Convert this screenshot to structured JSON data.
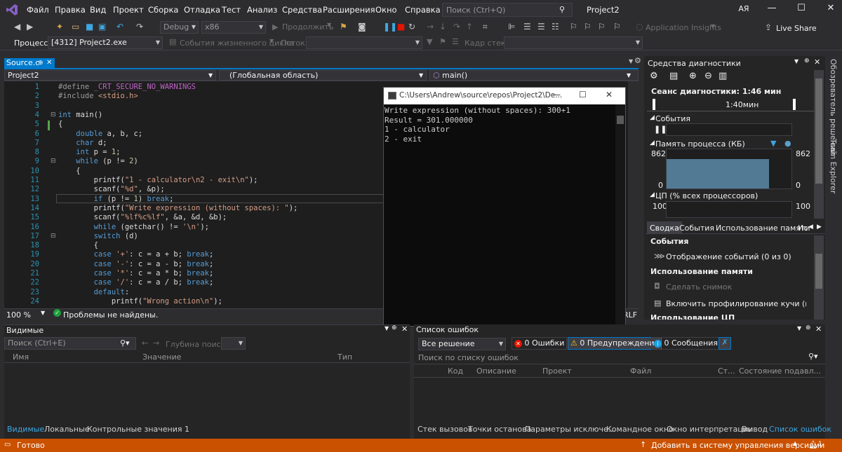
{
  "menu": [
    "Файл",
    "Правка",
    "Вид",
    "Проект",
    "Сборка",
    "Отладка",
    "Тест",
    "Анализ",
    "Средства",
    "Расширения",
    "Окно",
    "Справка"
  ],
  "search": {
    "placeholder": "Поиск (Ctrl+Q)"
  },
  "title": "Project2",
  "avatar": "АЯ",
  "toolbar": {
    "config": "Debug",
    "platform": "x86",
    "continue": "Продолжить",
    "insights": "Application Insights",
    "liveshare": "Live Share"
  },
  "toolbar2": {
    "process_label": "Процесс:",
    "process_value": "[4312] Project2.exe",
    "lifecycle": "События жизненного цикла",
    "thread": "Поток:",
    "frame": "Кадр стека:"
  },
  "editor": {
    "tab": "Source.c",
    "nav_project": "Project2",
    "nav_scope": "(Глобальная область)",
    "nav_func": "main()",
    "zoom": "100 %",
    "issues": "Проблемы не найдены.",
    "lines": [
      {
        "n": "1",
        "html": "<span class=\"pp\">#define</span> <span class=\"mac\">_CRT_SECURE_NO_WARNINGS</span>"
      },
      {
        "n": "2",
        "html": "<span class=\"pp\">#include</span> <span class=\"str\">&lt;stdio.h&gt;</span>"
      },
      {
        "n": "3",
        "html": ""
      },
      {
        "n": "4",
        "html": "<span class=\"kw\">int</span> main()"
      },
      {
        "n": "5",
        "html": "{"
      },
      {
        "n": "6",
        "html": "    <span class=\"kw\">double</span> a, b, c;"
      },
      {
        "n": "7",
        "html": "    <span class=\"kw\">char</span> d;"
      },
      {
        "n": "8",
        "html": "    <span class=\"kw\">int</span> p = <span class=\"num\">1</span>;"
      },
      {
        "n": "9",
        "html": "    <span class=\"kw\">while</span> (p != <span class=\"num\">2</span>)"
      },
      {
        "n": "10",
        "html": "    {"
      },
      {
        "n": "11",
        "html": "        printf(<span class=\"str\">\"1 - calculator\\n2 - exit\\n\"</span>);"
      },
      {
        "n": "12",
        "html": "        scanf(<span class=\"str\">\"%d\"</span>, &amp;p);"
      },
      {
        "n": "13",
        "html": "        <span class=\"kw\">if</span> (p != <span class=\"num\">1</span>) <span class=\"kw\">break</span>;"
      },
      {
        "n": "14",
        "html": "        printf(<span class=\"str\">\"Write expression (without spaces): \"</span>);"
      },
      {
        "n": "15",
        "html": "        scanf(<span class=\"str\">\"%lf%c%lf\"</span>, &amp;a, &amp;d, &amp;b);"
      },
      {
        "n": "16",
        "html": "        <span class=\"kw\">while</span> (getchar() != <span class=\"str\">'\\n'</span>);"
      },
      {
        "n": "17",
        "html": "        <span class=\"kw\">switch</span> (d)"
      },
      {
        "n": "18",
        "html": "        {"
      },
      {
        "n": "19",
        "html": "        <span class=\"kw\">case</span> <span class=\"str\">'+'</span>: c = a + b; <span class=\"kw\">break</span>;"
      },
      {
        "n": "20",
        "html": "        <span class=\"kw\">case</span> <span class=\"str\">'-'</span>: c = a - b; <span class=\"kw\">break</span>;"
      },
      {
        "n": "21",
        "html": "        <span class=\"kw\">case</span> <span class=\"str\">'*'</span>: c = a * b; <span class=\"kw\">break</span>;"
      },
      {
        "n": "22",
        "html": "        <span class=\"kw\">case</span> <span class=\"str\">'/'</span>: c = a / b; <span class=\"kw\">break</span>;"
      },
      {
        "n": "23",
        "html": "        <span class=\"kw\">default</span>:"
      },
      {
        "n": "24",
        "html": "            printf(<span class=\"str\">\"Wrong action\\n\"</span>);"
      }
    ]
  },
  "console": {
    "title": "C:\\Users\\Andrew\\source\\repos\\Project2\\De...",
    "text": "Write expression (without spaces): 300+1\nResult = 301.000000\n1 - calculator\n2 - exit"
  },
  "diag": {
    "header": "Средства диагностики",
    "session": "Сеанс диагностики: 1:46 мин",
    "timemark": "1:40мин",
    "events": "События",
    "memory": "Память процесса (КБ)",
    "mem_max": "862",
    "mem_min": "0",
    "cpu": "ЦП (% всех процессоров)",
    "cpu_max": "100",
    "tabs": [
      "Сводка",
      "События",
      "Использование памяти",
      "Ис"
    ],
    "sec_events": "События",
    "show_events": "Отображение событий (0 из 0)",
    "sec_memory": "Использование памяти",
    "snapshot": "Сделать снимок",
    "heap": "Включить профилирование кучи (влияет на",
    "sec_cpu": "Использование ЦП"
  },
  "sidebar": {
    "solution": "Обозреватель решений",
    "team": "Team Explorer"
  },
  "locals": {
    "header": "Видимые",
    "search": "Поиск (Ctrl+E)",
    "depth": "Глубина поиска:",
    "cols": [
      "Имя",
      "Значение",
      "Тип"
    ],
    "tabs": [
      "Видимые",
      "Локальные",
      "Контрольные значения 1"
    ]
  },
  "errors": {
    "header": "Список ошибок",
    "scope": "Все решение",
    "err": "0 Ошибки",
    "warn": "0 Предупреждения",
    "msg": "0 Сообщения",
    "search": "Поиск по списку ошибок",
    "cols": [
      "Код",
      "Описание",
      "Проект",
      "Файл",
      "Ст...",
      "Состояние подавл..."
    ],
    "tabs": [
      "Стек вызовов",
      "Точки останова",
      "Параметры исключе...",
      "Командное окно",
      "Окно интерпретации",
      "Вывод",
      "Список ошибок"
    ]
  },
  "status": {
    "ready": "Готово",
    "vcs": "Добавить в систему управления версиями",
    "bell": "1"
  },
  "colors": {
    "accent": "#007acc",
    "status": "#ca5100"
  }
}
